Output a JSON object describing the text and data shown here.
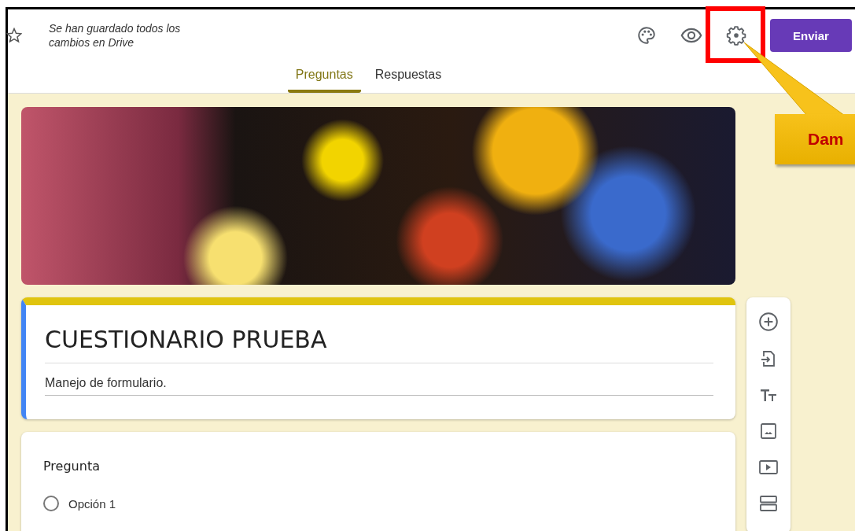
{
  "header": {
    "save_status": "Se han guardado todos los cambios en Drive",
    "send_button": "Enviar"
  },
  "tabs": [
    {
      "label": "Preguntas",
      "selected": true
    },
    {
      "label": "Respuestas",
      "selected": false
    }
  ],
  "form": {
    "title": "CUESTIONARIO PRUEBA",
    "description": "Manejo de formulario."
  },
  "question": {
    "title": "Pregunta",
    "options": [
      {
        "label": "Opción 1",
        "selected": false
      }
    ]
  },
  "callout": {
    "text": "Dam"
  }
}
